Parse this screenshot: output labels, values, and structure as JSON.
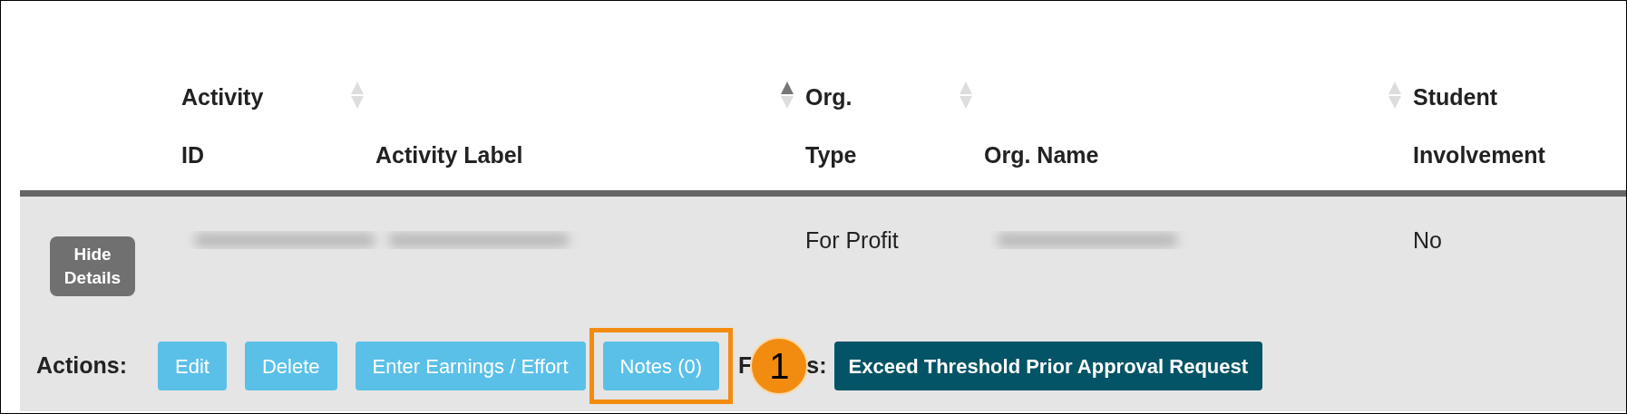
{
  "table": {
    "columns": [
      {
        "label_lines": [
          "Activity",
          "ID"
        ],
        "sortable": true,
        "sorted": false
      },
      {
        "label_lines": [
          "Activity Label"
        ],
        "sortable": true,
        "sorted": true
      },
      {
        "label_lines": [
          "Org.",
          "Type"
        ],
        "sortable": true,
        "sorted": false
      },
      {
        "label_lines": [
          "Org. Name"
        ],
        "sortable": true,
        "sorted": false
      },
      {
        "label_lines": [
          "Student",
          "Involvement"
        ],
        "sortable": false
      }
    ],
    "rows": [
      {
        "toggle": "Hide\nDetails",
        "cells": [
          {
            "kind": "redacted"
          },
          {
            "kind": "redacted"
          },
          {
            "kind": "text",
            "text": "For Profit"
          },
          {
            "kind": "redacted"
          },
          {
            "kind": "text",
            "text": "No"
          }
        ],
        "actions_label": "Actions:",
        "actions": [
          {
            "label": "Edit",
            "highlighted": false
          },
          {
            "label": "Delete",
            "highlighted": false
          },
          {
            "label": "Enter Earnings / Effort",
            "highlighted": false
          },
          {
            "label": "Notes (0)",
            "highlighted": true
          }
        ],
        "forms_label_parts": [
          "F",
          "s:"
        ],
        "callout": "1",
        "forms": [
          "Exceed Threshold Prior Approval Request"
        ]
      }
    ]
  }
}
